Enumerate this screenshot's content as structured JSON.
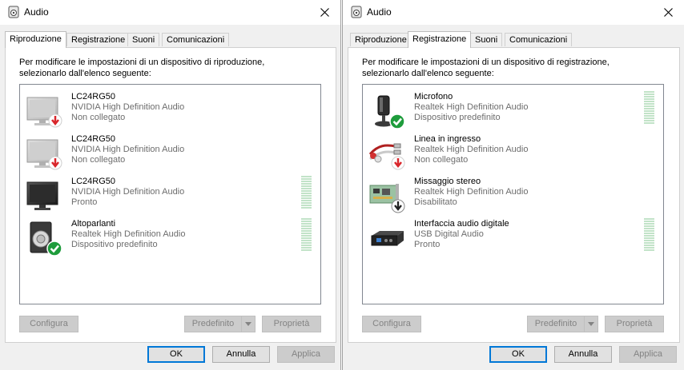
{
  "left": {
    "title": "Audio",
    "tabs": [
      {
        "label": "Riproduzione",
        "active": true
      },
      {
        "label": "Registrazione",
        "active": false
      },
      {
        "label": "Suoni",
        "active": false
      },
      {
        "label": "Comunicazioni",
        "active": false
      }
    ],
    "instructions_line1": "Per modificare le impostazioni di un dispositivo di riproduzione,",
    "instructions_line2": "selezionarlo dall'elenco seguente:",
    "devices": [
      {
        "name": "LC24RG50",
        "driver": "NVIDIA High Definition Audio",
        "status": "Non collegato",
        "icon": "monitor-icon",
        "badge": "unplugged-badge-icon"
      },
      {
        "name": "LC24RG50",
        "driver": "NVIDIA High Definition Audio",
        "status": "Non collegato",
        "icon": "monitor-icon",
        "badge": "unplugged-badge-icon"
      },
      {
        "name": "LC24RG50",
        "driver": "NVIDIA High Definition Audio",
        "status": "Pronto",
        "icon": "monitor-icon",
        "badge": null
      },
      {
        "name": "Altoparlanti",
        "driver": "Realtek High Definition Audio",
        "status": "Dispositivo predefinito",
        "icon": "speaker-icon",
        "badge": "default-check-badge-icon"
      }
    ],
    "buttons": {
      "configure": "Configura",
      "set_default": "Predefinito",
      "properties": "Proprietà",
      "ok": "OK",
      "cancel": "Annulla",
      "apply": "Applica"
    }
  },
  "right": {
    "title": "Audio",
    "tabs": [
      {
        "label": "Riproduzione",
        "active": false
      },
      {
        "label": "Registrazione",
        "active": true
      },
      {
        "label": "Suoni",
        "active": false
      },
      {
        "label": "Comunicazioni",
        "active": false
      }
    ],
    "instructions_line1": "Per modificare le impostazioni di un dispositivo di registrazione,",
    "instructions_line2": "selezionarlo dall'elenco seguente:",
    "devices": [
      {
        "name": "Microfono",
        "driver": "Realtek High Definition Audio",
        "status": "Dispositivo predefinito",
        "icon": "microphone-icon",
        "badge": "default-check-badge-icon"
      },
      {
        "name": "Linea in ingresso",
        "driver": "Realtek High Definition Audio",
        "status": "Non collegato",
        "icon": "line-in-cable-icon",
        "badge": "unplugged-badge-icon"
      },
      {
        "name": "Missaggio stereo",
        "driver": "Realtek High Definition Audio",
        "status": "Disabilitato",
        "icon": "sound-card-icon",
        "badge": "disabled-badge-icon"
      },
      {
        "name": "Interfaccia audio digitale",
        "driver": "USB Digital Audio",
        "status": "Pronto",
        "icon": "usb-audio-interface-icon",
        "badge": null
      }
    ],
    "buttons": {
      "configure": "Configura",
      "set_default": "Predefinito",
      "properties": "Proprietà",
      "ok": "OK",
      "cancel": "Annulla",
      "apply": "Applica"
    }
  },
  "colors": {
    "accent": "#0078d7",
    "meter_green": "#c2e3c8",
    "check_green": "#1e9c3c",
    "unplug_red": "#d9262b"
  }
}
